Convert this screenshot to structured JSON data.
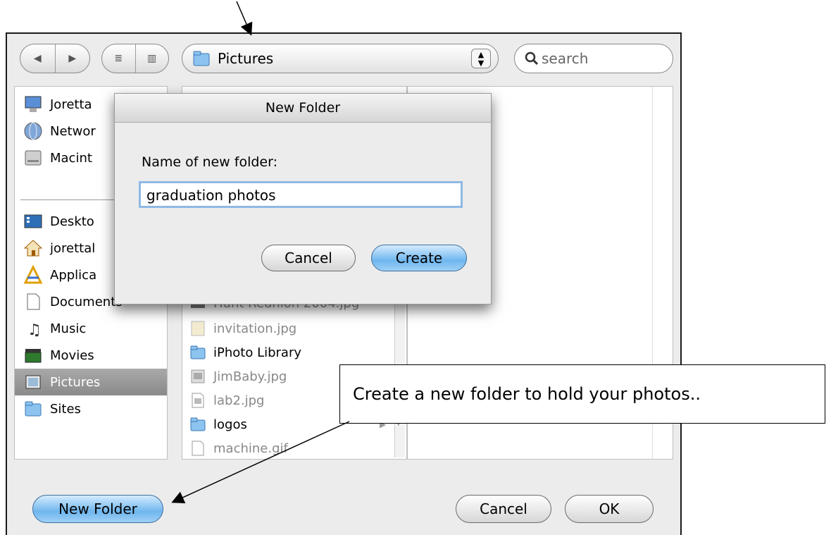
{
  "toolbar": {
    "back_label": "◀",
    "forward_label": "▶",
    "list_view_label": "≣",
    "column_view_label": "▥",
    "path_label": "Pictures",
    "search_placeholder": "search"
  },
  "sidebar": {
    "items": [
      {
        "label": "Joretta",
        "icon": "computer-icon"
      },
      {
        "label": "Networ",
        "icon": "network-icon"
      },
      {
        "label": "Macint",
        "icon": "hard-drive-icon"
      },
      {
        "label": "Deskto",
        "icon": "desktop-icon"
      },
      {
        "label": "jorettal",
        "icon": "home-icon"
      },
      {
        "label": "Applica",
        "icon": "applications-icon"
      },
      {
        "label": "Documents",
        "icon": "documents-icon"
      },
      {
        "label": "Music",
        "icon": "music-icon"
      },
      {
        "label": "Movies",
        "icon": "movies-icon"
      },
      {
        "label": "Pictures",
        "icon": "pictures-icon"
      },
      {
        "label": "Sites",
        "icon": "sites-icon"
      }
    ],
    "selected": "Pictures"
  },
  "files": [
    {
      "label": "Hunt Reunion 2004.jpg",
      "icon": "image-file-icon"
    },
    {
      "label": "invitation.jpg",
      "icon": "image-file-icon"
    },
    {
      "label": "iPhoto Library",
      "icon": "folder-icon"
    },
    {
      "label": "JimBaby.jpg",
      "icon": "image-file-icon"
    },
    {
      "label": "lab2.jpg",
      "icon": "image-file-icon"
    },
    {
      "label": "logos",
      "icon": "folder-icon"
    },
    {
      "label": "machine.gif",
      "icon": "image-file-icon"
    }
  ],
  "sheet": {
    "title": "New Folder",
    "prompt": "Name of new folder:",
    "folder_name": "graduation photos",
    "cancel_label": "Cancel",
    "create_label": "Create"
  },
  "footer": {
    "new_folder_label": "New Folder",
    "cancel_label": "Cancel",
    "ok_label": "OK"
  },
  "annotation": {
    "callout_text": "Create a new folder to hold your photos.."
  },
  "colors": {
    "aqua_blue": "#6fb6ee",
    "selection_gray": "#8a8a8a",
    "field_focus": "#8fb9e4"
  }
}
